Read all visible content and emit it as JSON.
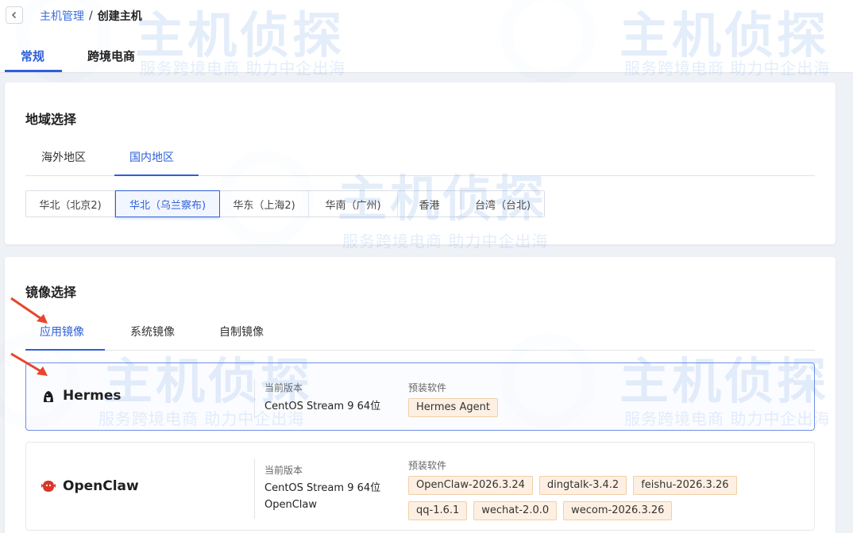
{
  "breadcrumb": {
    "parent": "主机管理",
    "separator": "/",
    "current": "创建主机"
  },
  "main_tabs": [
    {
      "label": "常规",
      "active": true
    },
    {
      "label": "跨境电商",
      "active": false
    }
  ],
  "region": {
    "title": "地域选择",
    "tabs": [
      {
        "label": "海外地区",
        "active": false
      },
      {
        "label": "国内地区",
        "active": true
      }
    ],
    "options": [
      {
        "label": "华北（北京2)",
        "active": false
      },
      {
        "label": "华北（乌兰察布)",
        "active": true
      },
      {
        "label": "华东（上海2)",
        "active": false
      },
      {
        "label": "华南（广州)",
        "active": false
      },
      {
        "label": "香港",
        "active": false
      },
      {
        "label": "台湾（台北)",
        "active": false
      }
    ]
  },
  "image": {
    "title": "镜像选择",
    "tabs": [
      {
        "label": "应用镜像",
        "active": true
      },
      {
        "label": "系统镜像",
        "active": false
      },
      {
        "label": "自制镜像",
        "active": false
      }
    ],
    "rows": [
      {
        "name": "Hermes",
        "version_label": "当前版本",
        "version": "CentOS Stream 9 64位",
        "software_label": "预装软件",
        "software": [
          "Hermes Agent"
        ],
        "selected": true
      },
      {
        "name": "OpenClaw",
        "version_label": "当前版本",
        "version": "CentOS Stream 9 64位",
        "version_extra": "OpenClaw",
        "software_label": "预装软件",
        "software": [
          "OpenClaw-2026.3.24",
          "dingtalk-3.4.2",
          "feishu-2026.3.26",
          "qq-1.6.1",
          "wechat-2.0.0",
          "wecom-2026.3.26"
        ],
        "selected": false
      }
    ]
  },
  "watermark": {
    "brand": "主机侦探",
    "slogan": "服务跨境电商 助力中企出海"
  },
  "colors": {
    "accent": "#2f5fd8",
    "tag_bg": "#fdf0e3",
    "tag_border": "#f2cfa8",
    "arrow": "#e8452c",
    "openclaw_logo": "#d8372a"
  },
  "icons": {
    "back": "chevron-left-icon",
    "hermes_logo": "hermes-logo-icon",
    "openclaw_logo": "openclaw-logo-icon"
  }
}
